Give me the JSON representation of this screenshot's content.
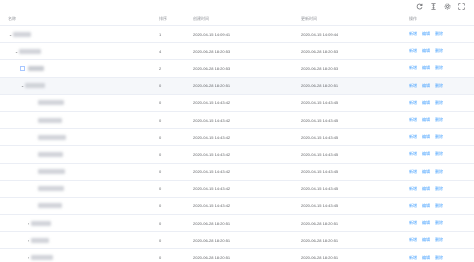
{
  "toolbar": {
    "icons": [
      "refresh-icon",
      "column-height-icon",
      "settings-icon",
      "fullscreen-icon"
    ]
  },
  "columns": {
    "name": "名称",
    "sort": "排序",
    "created": "创建时间",
    "updated": "更新时间",
    "ops": "操作"
  },
  "ops": {
    "add": "新增",
    "edit": "编辑",
    "delete": "删除"
  },
  "rows": [
    {
      "sort": "1",
      "created": "2020-04-15 14:09:41",
      "updated": "2020-04-15 14:09:44"
    },
    {
      "sort": "4",
      "created": "2020-06-28 18:20:53",
      "updated": "2020-06-28 18:20:53"
    },
    {
      "sort": "2",
      "created": "2020-06-28 18:20:53",
      "updated": "2020-06-28 18:20:53"
    },
    {
      "sort": "0",
      "created": "2020-06-28 18:20:51",
      "updated": "2020-06-28 18:20:51"
    },
    {
      "sort": "0",
      "created": "2020-04-15 14:43:42",
      "updated": "2020-04-15 14:43:45"
    },
    {
      "sort": "0",
      "created": "2020-04-15 14:43:42",
      "updated": "2020-04-15 14:43:45"
    },
    {
      "sort": "0",
      "created": "2020-04-15 14:43:42",
      "updated": "2020-04-15 14:43:45"
    },
    {
      "sort": "0",
      "created": "2020-04-15 14:43:42",
      "updated": "2020-04-15 14:43:45"
    },
    {
      "sort": "0",
      "created": "2020-04-15 14:43:42",
      "updated": "2020-04-15 14:43:45"
    },
    {
      "sort": "0",
      "created": "2020-04-15 14:43:42",
      "updated": "2020-04-15 14:43:45"
    },
    {
      "sort": "0",
      "created": "2020-04-15 14:43:42",
      "updated": "2020-04-15 14:43:45"
    },
    {
      "sort": "0",
      "created": "2020-06-28 18:20:51",
      "updated": "2020-06-28 18:20:51"
    },
    {
      "sort": "0",
      "created": "2020-06-28 18:20:51",
      "updated": "2020-06-28 18:20:51"
    },
    {
      "sort": "0",
      "created": "2020-06-28 18:20:51",
      "updated": "2020-06-28 18:20:51"
    }
  ]
}
